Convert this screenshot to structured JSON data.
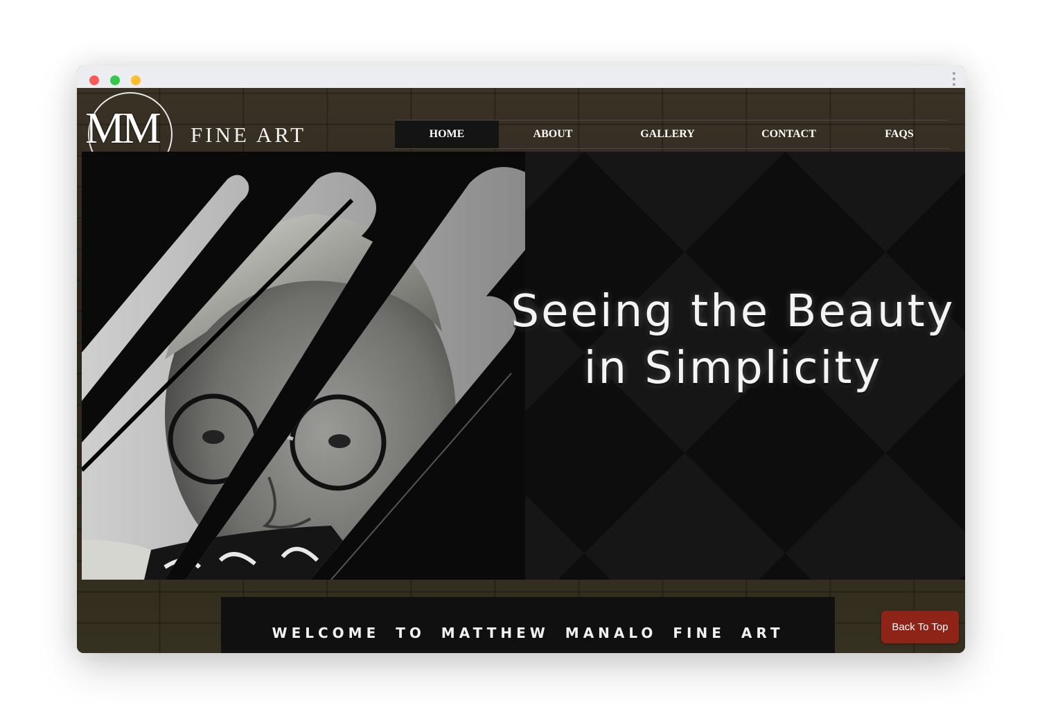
{
  "window": {
    "traffic_lights": [
      "close",
      "maximize",
      "minimize"
    ],
    "menu_icon": "kebab-menu-icon"
  },
  "logo": {
    "monogram": "MM",
    "text": "FINE ART"
  },
  "nav": {
    "items": [
      {
        "label": "HOME",
        "active": true
      },
      {
        "label": "ABOUT",
        "active": false
      },
      {
        "label": "GALLERY",
        "active": false
      },
      {
        "label": "CONTACT",
        "active": false
      },
      {
        "label": "FAQS",
        "active": false
      }
    ]
  },
  "hero": {
    "line1": "Seeing the Beauty",
    "line2": "in Simplicity",
    "image": "black-and-white-child-with-glasses-photo"
  },
  "welcome": {
    "text": "WELCOME TO MATTHEW MANALO FINE ART"
  },
  "back_to_top": {
    "label": "Back To Top"
  },
  "colors": {
    "accent_button": "#8e2318",
    "nav_active_bg": "#141414",
    "hero_bg": "#0d0d0d"
  }
}
